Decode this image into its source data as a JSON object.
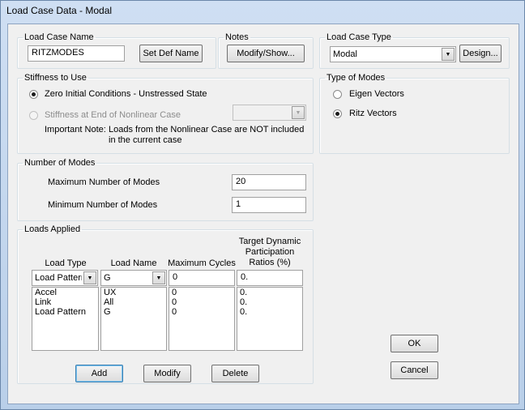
{
  "window": {
    "title": "Load Case Data - Modal"
  },
  "load_case_name": {
    "legend": "Load Case Name",
    "value": "RITZMODES",
    "set_def_name_label": "Set Def Name"
  },
  "notes": {
    "legend": "Notes",
    "button_label": "Modify/Show..."
  },
  "load_case_type": {
    "legend": "Load Case Type",
    "selected": "Modal",
    "design_label": "Design..."
  },
  "stiffness": {
    "legend": "Stiffness to Use",
    "option_zero": "Zero Initial Conditions - Unstressed State",
    "option_nonlinear": "Stiffness at End of Nonlinear Case",
    "note_label": "Important Note:",
    "note_text_1": "Loads from the Nonlinear Case are NOT included",
    "note_text_2": "in the current case",
    "selected": "zero"
  },
  "type_of_modes": {
    "legend": "Type of Modes",
    "option_eigen": "Eigen Vectors",
    "option_ritz": "Ritz Vectors",
    "selected": "ritz"
  },
  "number_of_modes": {
    "legend": "Number of Modes",
    "max_label": "Maximum Number of Modes",
    "max_value": "20",
    "min_label": "Minimum Number of Modes",
    "min_value": "1"
  },
  "loads_applied": {
    "legend": "Loads Applied",
    "headers": {
      "load_type": "Load Type",
      "load_name": "Load Name",
      "max_cycles": "Maximum Cycles",
      "target_1": "Target Dynamic",
      "target_2": "Participation",
      "target_3": "Ratios (%)"
    },
    "edit_row": {
      "load_type": "Load Pattern",
      "load_name": "G",
      "max_cycles": "0",
      "ratio": "0."
    },
    "rows": [
      {
        "load_type": "Accel",
        "load_name": "UX",
        "max_cycles": "0",
        "ratio": "0."
      },
      {
        "load_type": "Link",
        "load_name": "All",
        "max_cycles": "0",
        "ratio": "0."
      },
      {
        "load_type": "Load Pattern",
        "load_name": "G",
        "max_cycles": "0",
        "ratio": "0."
      }
    ],
    "add_label": "Add",
    "modify_label": "Modify",
    "delete_label": "Delete"
  },
  "dialog_buttons": {
    "ok_label": "OK",
    "cancel_label": "Cancel"
  }
}
